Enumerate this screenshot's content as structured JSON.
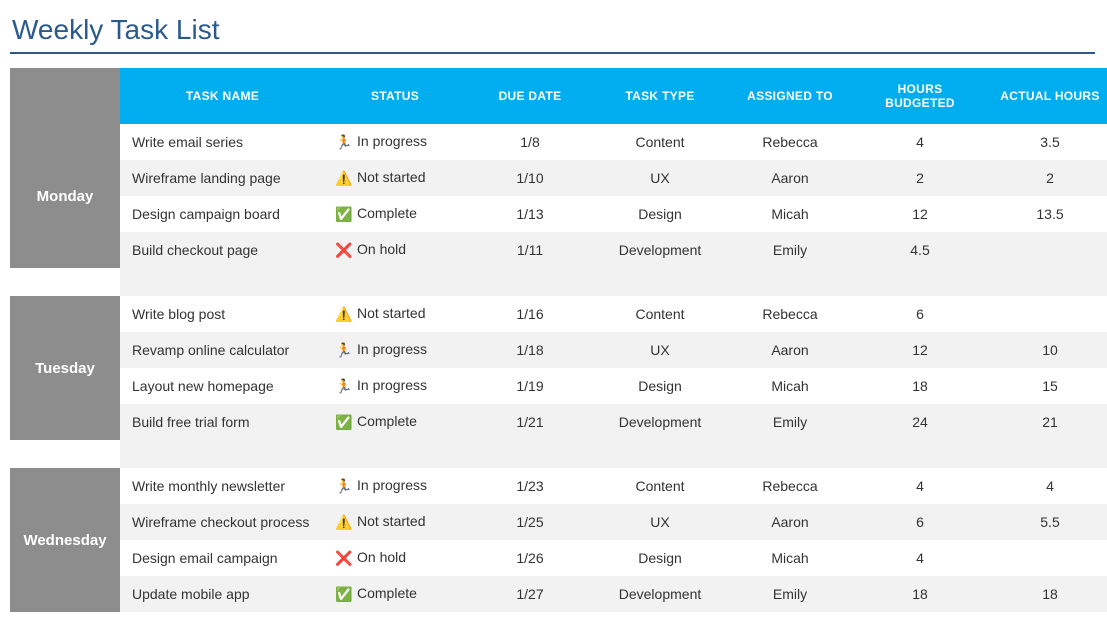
{
  "title": "Weekly Task List",
  "headers": {
    "task": "TASK NAME",
    "status": "STATUS",
    "due": "DUE DATE",
    "type": "TASK TYPE",
    "assigned": "ASSIGNED TO",
    "budget": "HOURS BUDGETED",
    "actual": "ACTUAL HOURS"
  },
  "status_icons": {
    "in_progress": "🏃",
    "not_started": "⚠️",
    "complete": "✅",
    "on_hold": "❌"
  },
  "status_labels": {
    "in_progress": "In progress",
    "not_started": "Not started",
    "complete": "Complete",
    "on_hold": "On hold"
  },
  "days": [
    {
      "name": "Monday",
      "tasks": [
        {
          "name": "Write email series",
          "status": "in_progress",
          "due": "1/8",
          "type": "Content",
          "assigned": "Rebecca",
          "budget": "4",
          "actual": "3.5"
        },
        {
          "name": "Wireframe landing page",
          "status": "not_started",
          "due": "1/10",
          "type": "UX",
          "assigned": "Aaron",
          "budget": "2",
          "actual": "2"
        },
        {
          "name": "Design campaign board",
          "status": "complete",
          "due": "1/13",
          "type": "Design",
          "assigned": "Micah",
          "budget": "12",
          "actual": "13.5"
        },
        {
          "name": "Build checkout page",
          "status": "on_hold",
          "due": "1/11",
          "type": "Development",
          "assigned": "Emily",
          "budget": "4.5",
          "actual": ""
        }
      ]
    },
    {
      "name": "Tuesday",
      "tasks": [
        {
          "name": "Write blog post",
          "status": "not_started",
          "due": "1/16",
          "type": "Content",
          "assigned": "Rebecca",
          "budget": "6",
          "actual": ""
        },
        {
          "name": "Revamp online calculator",
          "status": "in_progress",
          "due": "1/18",
          "type": "UX",
          "assigned": "Aaron",
          "budget": "12",
          "actual": "10"
        },
        {
          "name": "Layout new homepage",
          "status": "in_progress",
          "due": "1/19",
          "type": "Design",
          "assigned": "Micah",
          "budget": "18",
          "actual": "15"
        },
        {
          "name": "Build free trial form",
          "status": "complete",
          "due": "1/21",
          "type": "Development",
          "assigned": "Emily",
          "budget": "24",
          "actual": "21"
        }
      ]
    },
    {
      "name": "Wednesday",
      "tasks": [
        {
          "name": "Write monthly newsletter",
          "status": "in_progress",
          "due": "1/23",
          "type": "Content",
          "assigned": "Rebecca",
          "budget": "4",
          "actual": "4"
        },
        {
          "name": "Wireframe checkout process",
          "status": "not_started",
          "due": "1/25",
          "type": "UX",
          "assigned": "Aaron",
          "budget": "6",
          "actual": "5.5"
        },
        {
          "name": "Design email campaign",
          "status": "on_hold",
          "due": "1/26",
          "type": "Design",
          "assigned": "Micah",
          "budget": "4",
          "actual": ""
        },
        {
          "name": "Update mobile app",
          "status": "complete",
          "due": "1/27",
          "type": "Development",
          "assigned": "Emily",
          "budget": "18",
          "actual": "18"
        }
      ]
    }
  ]
}
